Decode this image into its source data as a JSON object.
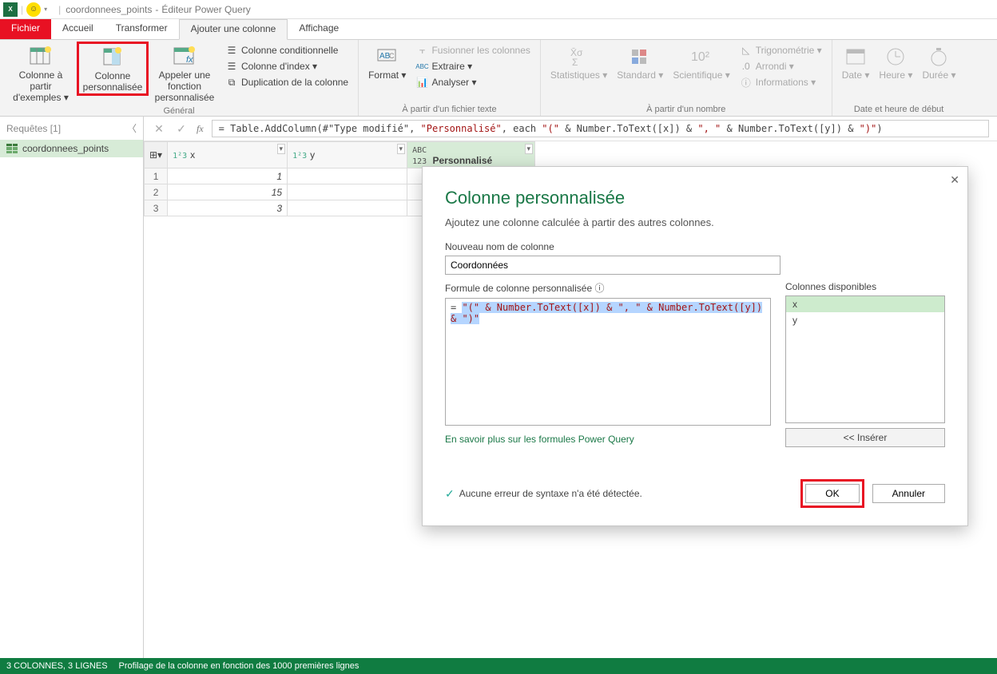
{
  "title": {
    "file": "coordonnees_points",
    "app": "Éditeur Power Query"
  },
  "tabs": {
    "file": "Fichier",
    "home": "Accueil",
    "transform": "Transformer",
    "addcol": "Ajouter une colonne",
    "view": "Affichage"
  },
  "ribbon": {
    "general": {
      "from_examples": "Colonne à partir d'exemples ▾",
      "custom_column": "Colonne personnalisée",
      "invoke_fn": "Appeler une fonction personnalisée",
      "conditional": "Colonne conditionnelle",
      "index": "Colonne d'index ▾",
      "duplicate": "Duplication de la colonne",
      "label": "Général"
    },
    "text": {
      "format": "Format ▾",
      "merge": "Fusionner les colonnes",
      "extract": "Extraire ▾",
      "analyze": "Analyser ▾",
      "label": "À partir d'un fichier texte"
    },
    "number": {
      "stats": "Statistiques ▾",
      "standard": "Standard ▾",
      "sci": "Scientifique ▾",
      "trig": "Trigonométrie ▾",
      "round": "Arrondi ▾",
      "info": "Informations ▾",
      "label": "À partir d'un nombre"
    },
    "datetime": {
      "date": "Date ▾",
      "time": "Heure ▾",
      "duration": "Durée ▾",
      "label": "Date et heure de début"
    }
  },
  "queries": {
    "heading": "Requêtes [1]",
    "items": [
      "coordonnees_points"
    ]
  },
  "formula_bar": {
    "prefix": "= Table.AddColumn(#\"Type modifié\", ",
    "str1": "\"Personnalisé\"",
    "mid": ", each ",
    "str2": "\"(\"",
    "p1": " & Number.ToText([x]) & ",
    "str3": "\", \"",
    "p2": " & Number.ToText([y]) & ",
    "str4": "\")\"",
    "suffix": ")"
  },
  "columns": {
    "x": "x",
    "y": "y",
    "p": "Personnalisé"
  },
  "rows": [
    {
      "n": "1",
      "x": "1"
    },
    {
      "n": "2",
      "x": "15"
    },
    {
      "n": "3",
      "x": "3"
    }
  ],
  "dialog": {
    "title": "Colonne personnalisée",
    "subtitle": "Ajoutez une colonne calculée à partir des autres colonnes.",
    "name_label": "Nouveau nom de colonne",
    "name_value": "Coordonnées",
    "formula_label": "Formule de colonne personnalisée ⓘ",
    "formula_eq": "= ",
    "formula_body": "\"(\" & Number.ToText([x]) & \", \" & Number.ToText([y]) & \")\"",
    "avail_label": "Colonnes disponibles",
    "avail": [
      "x",
      "y"
    ],
    "insert": "<< Insérer",
    "learn": "En savoir plus sur les formules Power Query",
    "status": "Aucune erreur de syntaxe n'a été détectée.",
    "ok": "OK",
    "cancel": "Annuler"
  },
  "statusbar": {
    "cols": "3 COLONNES, 3 LIGNES",
    "profiling": "Profilage de la colonne en fonction des 1000 premières lignes"
  }
}
